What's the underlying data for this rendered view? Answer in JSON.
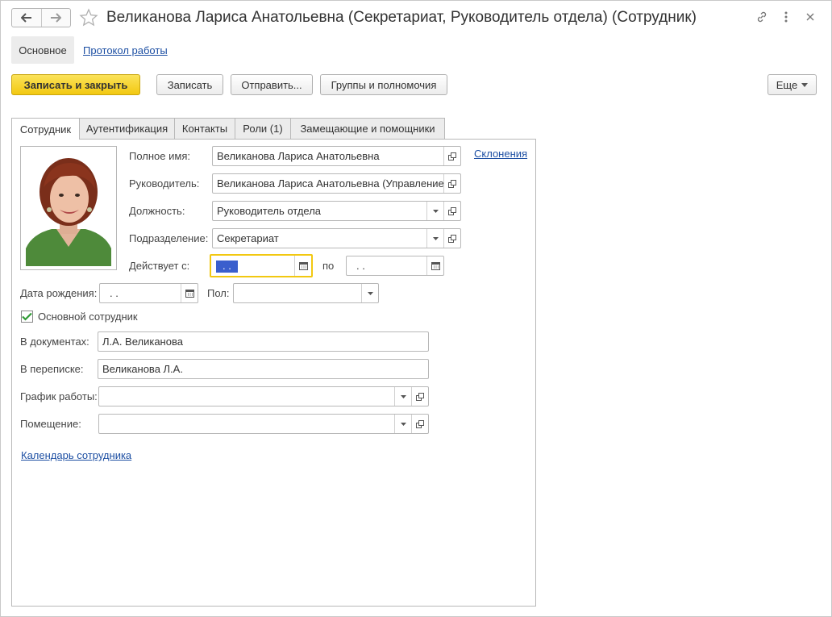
{
  "window": {
    "title": "Великанова Лариса Анатольевна (Секретариат, Руководитель отдела) (Сотрудник)"
  },
  "section_nav": {
    "active": "Основное",
    "link": "Протокол работы"
  },
  "toolbar": {
    "save_close": "Записать и закрыть",
    "save": "Записать",
    "send": "Отправить...",
    "groups": "Группы и полномочия",
    "more": "Еще"
  },
  "tabs": [
    {
      "label": "Сотрудник"
    },
    {
      "label": "Аутентификация"
    },
    {
      "label": "Контакты"
    },
    {
      "label": "Роли (1)"
    },
    {
      "label": "Замещающие и помощники"
    }
  ],
  "form": {
    "full_name_label": "Полное имя:",
    "full_name_value": "Великанова Лариса Анатольевна",
    "declensions_link": "Склонения",
    "manager_label": "Руководитель:",
    "manager_value": "Великанова Лариса Анатольевна (Управление",
    "position_label": "Должность:",
    "position_value": "Руководитель отдела",
    "department_label": "Подразделение:",
    "department_value": "Секретариат",
    "valid_from_label": "Действует с:",
    "valid_from_value": ". .",
    "valid_to_label": "по",
    "valid_to_value": ". .",
    "birth_label": "Дата рождения:",
    "birth_value": ". .",
    "gender_label": "Пол:",
    "gender_value": "",
    "main_employee_label": "Основной сотрудник",
    "main_employee_checked": true,
    "in_docs_label": "В документах:",
    "in_docs_value": "Л.А. Великанова",
    "in_mail_label": "В переписке:",
    "in_mail_value": "Великанова Л.А.",
    "schedule_label": "График работы:",
    "schedule_value": "",
    "room_label": "Помещение:",
    "room_value": "",
    "calendar_link": "Календарь сотрудника"
  },
  "colors": {
    "accent": "#f2c811",
    "link": "#1d4fa3",
    "selection": "#3a5fcd"
  }
}
